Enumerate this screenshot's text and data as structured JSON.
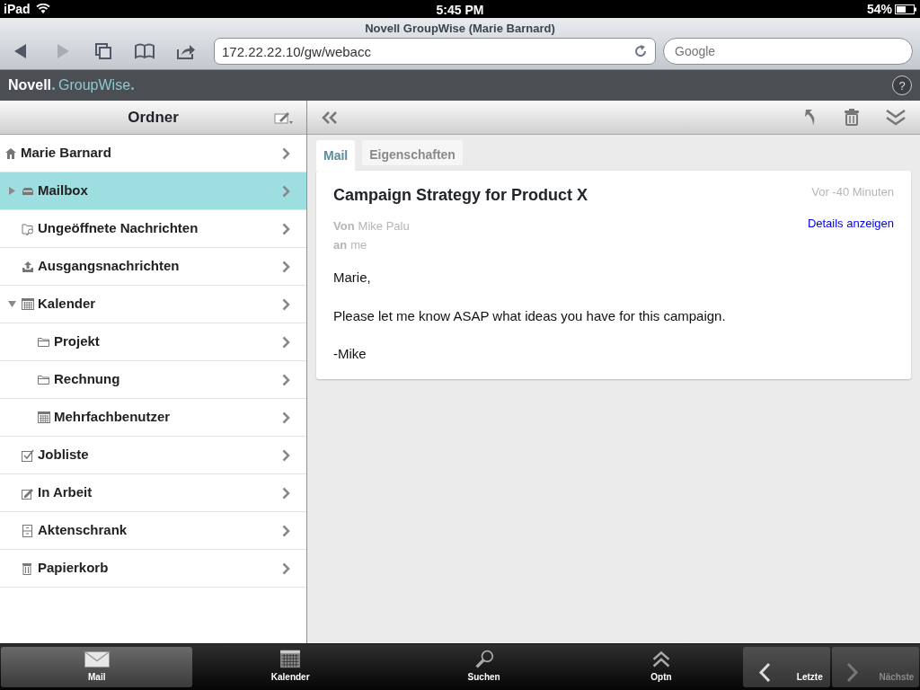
{
  "status_bar": {
    "device": "iPad",
    "time": "5:45 PM",
    "battery": "54%"
  },
  "browser": {
    "title": "Novell GroupWise (Marie Barnard)",
    "url": "172.22.22.10/gw/webacc",
    "search": {
      "placeholder": "Google"
    }
  },
  "app_header": {
    "brand": "Novell",
    "product": "GroupWise",
    "help": "?"
  },
  "sidebar": {
    "title": "Ordner",
    "items": [
      {
        "label": "Marie Barnard",
        "kind": "home",
        "selected": false
      },
      {
        "label": "Mailbox",
        "kind": "mailbox",
        "selected": true,
        "expanded": false
      },
      {
        "label": "Ungeöffnete Nachrichten",
        "kind": "search-folder",
        "selected": false
      },
      {
        "label": "Ausgangsnachrichten",
        "kind": "outbox",
        "selected": false
      },
      {
        "label": "Kalender",
        "kind": "calendar",
        "selected": false,
        "expanded": true,
        "children": [
          {
            "label": "Projekt",
            "kind": "folder",
            "selected": false
          },
          {
            "label": "Rechnung",
            "kind": "folder",
            "selected": false
          },
          {
            "label": "Mehrfachbenutzer",
            "kind": "calendar",
            "selected": false
          }
        ]
      },
      {
        "label": "Jobliste",
        "kind": "checklist",
        "selected": false
      },
      {
        "label": "In Arbeit",
        "kind": "draft",
        "selected": false
      },
      {
        "label": "Aktenschrank",
        "kind": "cabinet",
        "selected": false
      },
      {
        "label": "Papierkorb",
        "kind": "trash",
        "selected": false
      }
    ]
  },
  "message": {
    "tabs": [
      {
        "label": "Mail",
        "selected": true
      },
      {
        "label": "Eigenschaften",
        "selected": false
      }
    ],
    "subject": "Campaign Strategy for Product X",
    "time": "Vor -40 Minuten",
    "from_label": "Von",
    "from": "Mike Palu",
    "to_label": "an",
    "to": "me",
    "details_link": "Details anzeigen",
    "body": [
      "Marie,",
      "Please let me know ASAP what ideas you have for this campaign.",
      "-Mike"
    ]
  },
  "tab_bar": [
    {
      "label": "Mail",
      "kind": "mail",
      "selected": true,
      "disabled": false
    },
    {
      "label": "Kalender",
      "kind": "calendar",
      "selected": false,
      "disabled": false
    },
    {
      "label": "Suchen",
      "kind": "search",
      "selected": false,
      "disabled": false
    },
    {
      "label": "Optn",
      "kind": "options",
      "selected": false,
      "disabled": false
    },
    {
      "label": "Letzte",
      "kind": "previous",
      "selected": false,
      "disabled": false
    },
    {
      "label": "Nächste",
      "kind": "next",
      "selected": false,
      "disabled": true
    }
  ]
}
